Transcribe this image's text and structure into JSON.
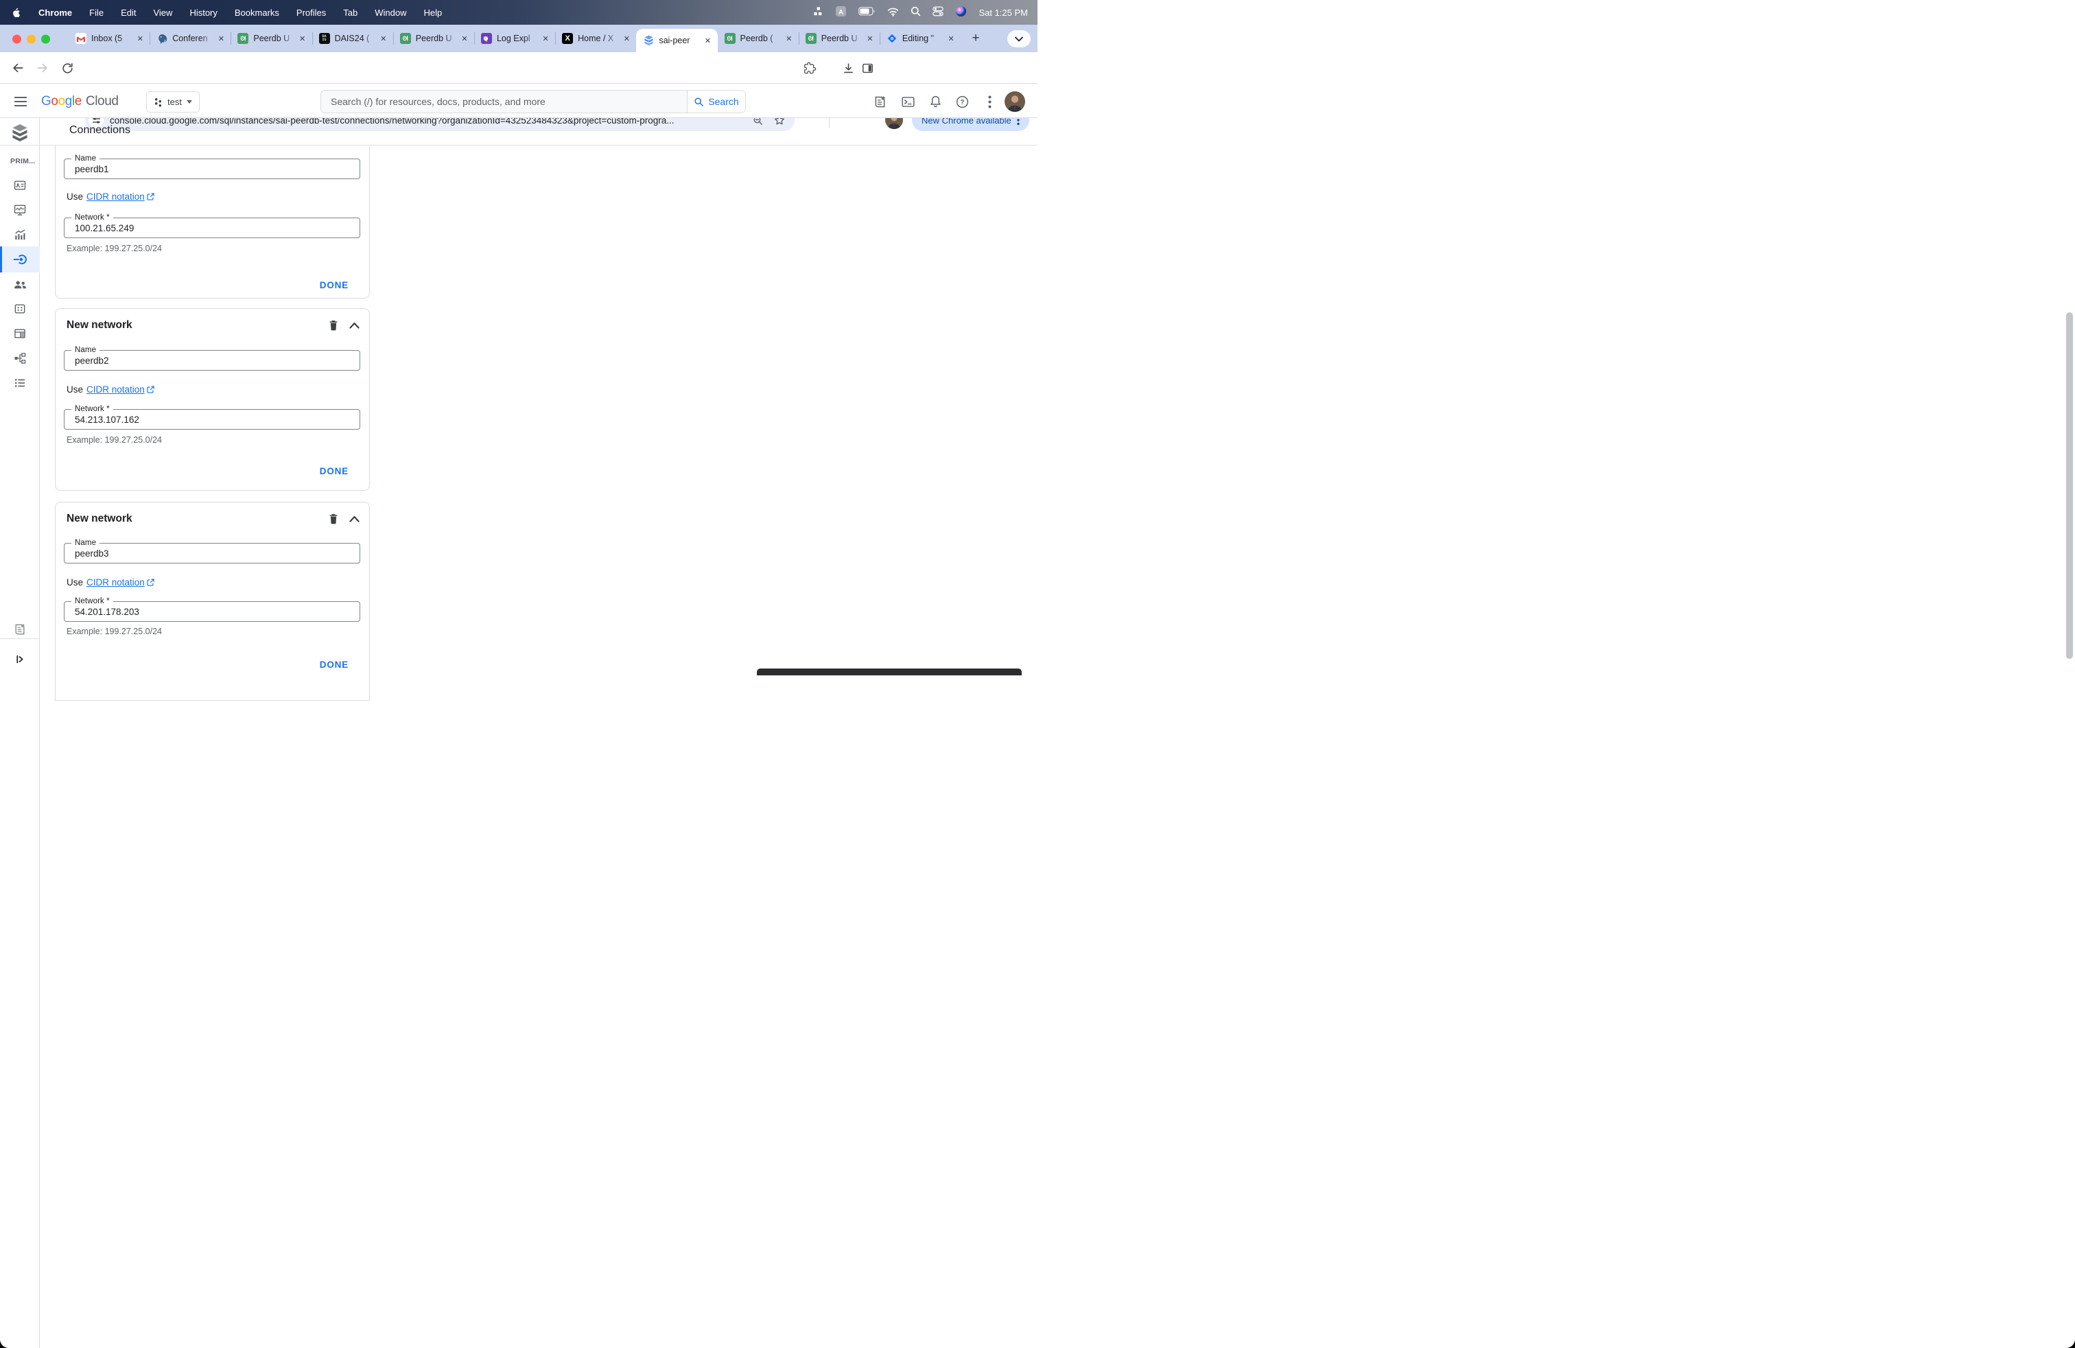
{
  "colors": {
    "accent_blue": "#1a73e8",
    "link_blue": "#1a73e8",
    "active_nav_bg": "#e8f0fe",
    "tabstrip_bg": "#c8d3ee",
    "update_pill_bg": "#d3e3fd",
    "update_pill_text": "#0d4d9e",
    "menubar_gradient_left": "#1d2b4d",
    "menubar_gradient_right": "#92969f"
  },
  "menubar": {
    "items": [
      "Chrome",
      "File",
      "Edit",
      "View",
      "History",
      "Bookmarks",
      "Profiles",
      "Tab",
      "Window",
      "Help"
    ],
    "status_icons": [
      "stats-blocks-icon",
      "a-app-icon",
      "battery-icon",
      "wifi-icon",
      "spotlight-search-icon",
      "control-center-icon",
      "siri-icon"
    ],
    "clock": "Sat 1:25 PM"
  },
  "browser": {
    "tabs": [
      {
        "title": "Inbox (5",
        "icon": "gmail"
      },
      {
        "title": "Conferen",
        "icon": "postgresql"
      },
      {
        "title": "Peerdb U",
        "icon": "peerdb"
      },
      {
        "title": "DAIS24 (",
        "icon": "dais"
      },
      {
        "title": "Peerdb U",
        "icon": "peerdb"
      },
      {
        "title": "Log Expl",
        "icon": "datadog"
      },
      {
        "title": "Home / X",
        "icon": "x"
      },
      {
        "title": "sai-peer",
        "icon": "cloud-sql",
        "active": true
      },
      {
        "title": "Peerdb (",
        "icon": "peerdb"
      },
      {
        "title": "Peerdb U",
        "icon": "peerdb"
      },
      {
        "title": "Editing \"",
        "icon": "my-maps"
      }
    ],
    "url": "console.cloud.google.com/sql/instances/sai-peerdb-test/connections/networking?organizationId=432523484323&project=custom-progra...",
    "update_button": "New Chrome available"
  },
  "gcloud": {
    "logo_letters": [
      {
        "ch": "G",
        "color": "#4285F4"
      },
      {
        "ch": "o",
        "color": "#EA4335"
      },
      {
        "ch": "o",
        "color": "#FBBC05"
      },
      {
        "ch": "g",
        "color": "#4285F4"
      },
      {
        "ch": "l",
        "color": "#34A853"
      },
      {
        "ch": "e",
        "color": "#EA4335"
      }
    ],
    "logo_cloud": "Cloud",
    "project": "test",
    "search_placeholder": "Search (/) for resources, docs, products, and more",
    "search_button": "Search"
  },
  "sidebar": {
    "section_label": "PRIM...",
    "items": [
      {
        "name": "overview",
        "active": false
      },
      {
        "name": "system-insights",
        "active": false
      },
      {
        "name": "query-insights",
        "active": false
      },
      {
        "name": "connections",
        "active": true
      },
      {
        "name": "users",
        "active": false
      },
      {
        "name": "databases",
        "active": false
      },
      {
        "name": "backups",
        "active": false
      },
      {
        "name": "replicas",
        "active": false
      },
      {
        "name": "operations",
        "active": false
      }
    ]
  },
  "page": {
    "title": "Connections"
  },
  "cards": [
    {
      "name_label": "Name",
      "name_value": "peerdb1",
      "cidr_prefix": "Use",
      "cidr_link": "CIDR notation",
      "network_label": "Network *",
      "network_value": "100.21.65.249",
      "helper": "Example: 199.27.25.0/24",
      "done": "DONE"
    },
    {
      "header": "New network",
      "name_label": "Name",
      "name_value": "peerdb2",
      "cidr_prefix": "Use",
      "cidr_link": "CIDR notation",
      "network_label": "Network *",
      "network_value": "54.213.107.162",
      "helper": "Example: 199.27.25.0/24",
      "done": "DONE"
    },
    {
      "header": "New network",
      "name_label": "Name",
      "name_value": "peerdb3",
      "cidr_prefix": "Use",
      "cidr_link": "CIDR notation",
      "network_label": "Network *",
      "network_value": "54.201.178.203",
      "helper": "Example: 199.27.25.0/24",
      "done": "DONE"
    }
  ]
}
